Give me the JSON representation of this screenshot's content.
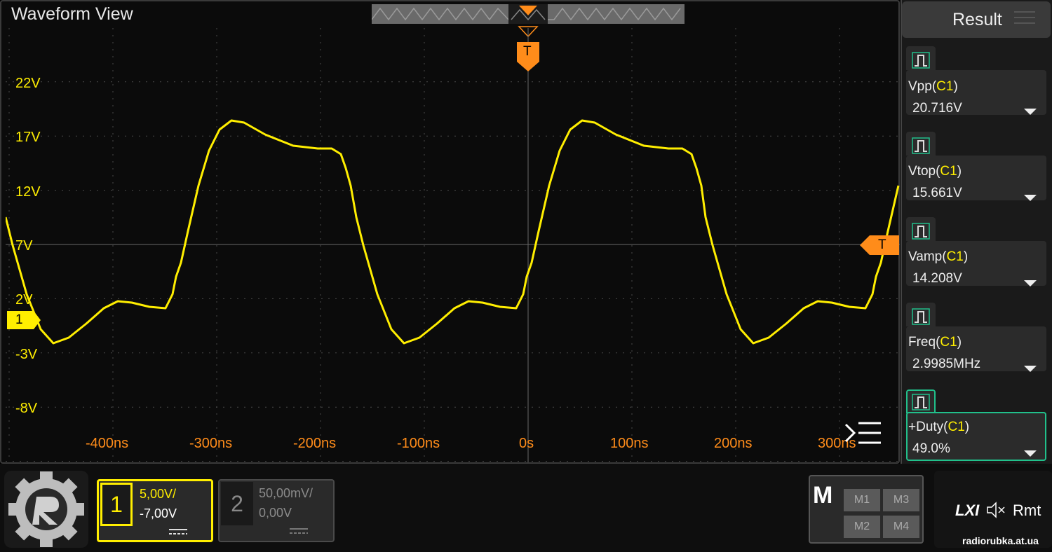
{
  "window": {
    "title": "Waveform View"
  },
  "colors": {
    "ch1": "#ffee00",
    "trigger": "#ff8c1a",
    "grid": "#4a4a4a",
    "accent_active": "#21c08b"
  },
  "y_axis": {
    "labels": [
      "22V",
      "17V",
      "12V",
      "7V",
      "2V",
      "-3V",
      "-8V"
    ]
  },
  "x_axis": {
    "labels": [
      "-400ns",
      "-300ns",
      "-200ns",
      "-100ns",
      "0s",
      "100ns",
      "200ns",
      "300ns"
    ]
  },
  "markers": {
    "ch1_label": "1",
    "trigger_label": "T",
    "trigger_pos_label": "T"
  },
  "result": {
    "title": "Result",
    "measurements": [
      {
        "name": "Vpp",
        "source": "C1",
        "value": "20.716V"
      },
      {
        "name": "Vtop",
        "source": "C1",
        "value": "15.661V"
      },
      {
        "name": "Vamp",
        "source": "C1",
        "value": "14.208V"
      },
      {
        "name": "Freq",
        "source": "C1",
        "value": "2.9985MHz"
      },
      {
        "name": "+Duty",
        "source": "C1",
        "value": "49.0%"
      }
    ]
  },
  "channels": [
    {
      "num": "1",
      "scale": "5,00V/",
      "offset": "-7,00V",
      "active": true
    },
    {
      "num": "2",
      "scale": "50,00mV/",
      "offset": "0,00V",
      "active": false
    }
  ],
  "math": {
    "label": "M",
    "buttons": [
      "M1",
      "M3",
      "M2",
      "M4"
    ]
  },
  "status": {
    "lxi": "LXI",
    "remote": "Rmt"
  },
  "watermark": "radiorubka.at.ua"
}
